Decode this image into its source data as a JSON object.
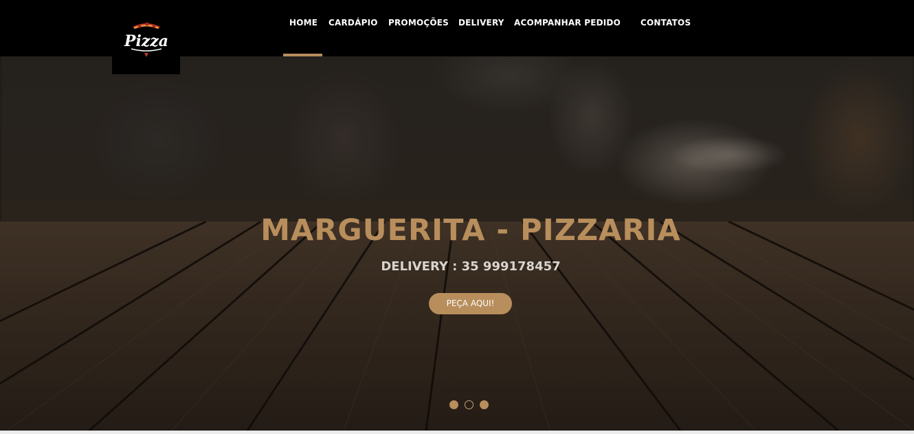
{
  "brand": {
    "logo_text": "Pizza",
    "accent_color": "#b88e5c"
  },
  "nav": {
    "items": [
      {
        "label": "HOME",
        "active": true
      },
      {
        "label": "CARDÁPIO"
      },
      {
        "label": "PROMOÇÕES"
      },
      {
        "label": "DELIVERY"
      },
      {
        "label": "ACOMPANHAR PEDIDO"
      },
      {
        "label": "CONTATOS"
      }
    ]
  },
  "hero": {
    "title": "MARGUERITA - PIZZARIA",
    "subtitle": "DELIVERY : 35 999178457",
    "cta_label": "PEÇA AQUI!",
    "slides": {
      "count": 3,
      "active_index": 1
    }
  }
}
